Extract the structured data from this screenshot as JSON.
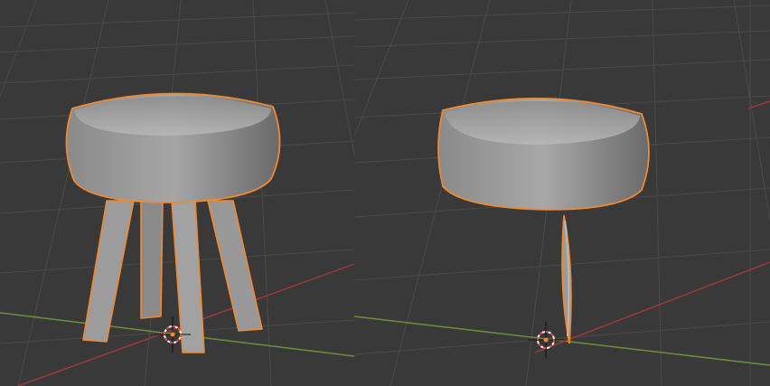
{
  "theme": {
    "background": "#393939",
    "grid": "#4a4a4a",
    "x_axis": "#9a3a3a",
    "y_axis": "#6d8f3a",
    "selection_outline": "#f0892f",
    "mesh_light": "#b4b4b4",
    "mesh_dark": "#6f6f6f",
    "cursor_red": "#e05050",
    "cursor_white": "#ffffff"
  },
  "viewports": [
    {
      "name": "left-viewport",
      "object": "stool",
      "legs": 4,
      "selected": true,
      "cursor": "3d-cursor-icon"
    },
    {
      "name": "right-viewport",
      "object": "stool",
      "legs": 1,
      "selected": true,
      "cursor": "3d-cursor-icon"
    }
  ]
}
